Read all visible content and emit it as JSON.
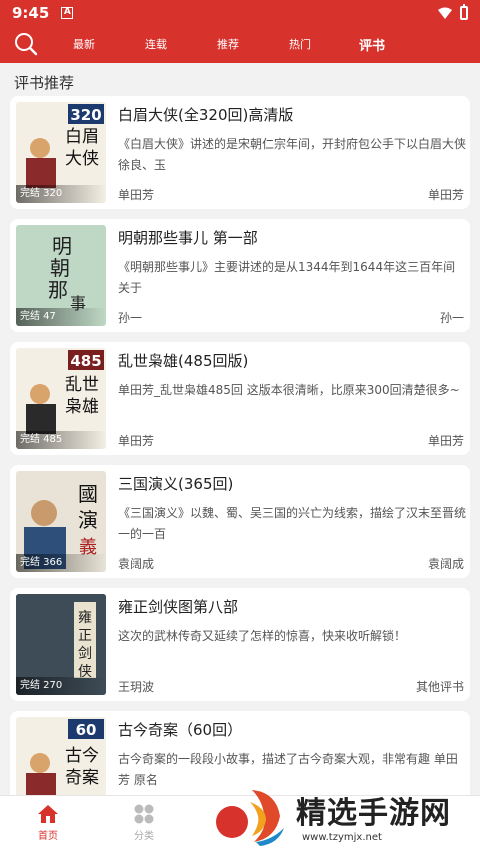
{
  "status": {
    "time": "9:45",
    "notif_letter": "A"
  },
  "nav": {
    "tabs": [
      {
        "label": "最新",
        "active": false
      },
      {
        "label": "连载",
        "active": false
      },
      {
        "label": "推荐",
        "active": false
      },
      {
        "label": "热门",
        "active": false
      },
      {
        "label": "评书",
        "active": true
      }
    ]
  },
  "section_title": "评书推荐",
  "books": [
    {
      "title": "白眉大侠(全320回)高清版",
      "desc": "《白眉大侠》讲述的是宋朝仁宗年间，开封府包公手下以白眉大侠徐良、玉",
      "author": "单田芳",
      "right": "单田芳",
      "badge": "完结 320",
      "cover_num": "320",
      "cover_text": "白眉大侠",
      "cover_color": "#f4efe4"
    },
    {
      "title": "明朝那些事儿 第一部",
      "desc": "《明朝那些事儿》主要讲述的是从1344年到1644年这三百年间关于",
      "author": "孙一",
      "right": "孙一",
      "badge": "完结 47",
      "cover_num": "",
      "cover_text": "明朝那些事",
      "cover_color": "#bfd8c5"
    },
    {
      "title": "乱世枭雄(485回版)",
      "desc": "单田芳_乱世枭雄485回  这版本很清晰，比原来300回清楚很多~",
      "author": "单田芳",
      "right": "单田芳",
      "badge": "完结 485",
      "cover_num": "485",
      "cover_text": "乱世枭雄",
      "cover_color": "#f4efe4"
    },
    {
      "title": "三国演义(365回)",
      "desc": "《三国演义》以魏、蜀、吴三国的兴亡为线索，描绘了汉末至晋统一的一百",
      "author": "袁阔成",
      "right": "袁阔成",
      "badge": "完结 366",
      "cover_num": "",
      "cover_text": "三國演義",
      "cover_color": "#e8e3d6"
    },
    {
      "title": "雍正剑侠图第八部",
      "desc": "这次的武林传奇又延续了怎样的惊喜，快来收听解锁！",
      "author": "王玥波",
      "right": "其他评书",
      "badge": "完结 270",
      "cover_num": "",
      "cover_text": "雍正剑侠图",
      "cover_color": "#33404a"
    },
    {
      "title": "古今奇案（60回）",
      "desc": "古今奇案的一段段小故事，描述了古今奇案大观，非常有趣  单田芳 原名",
      "author": "",
      "right": "",
      "badge": "",
      "cover_num": "60",
      "cover_text": "古今奇案",
      "cover_color": "#f4efe4"
    }
  ],
  "bottom_nav": [
    {
      "label": "首页",
      "active": true
    },
    {
      "label": "分类",
      "active": false
    }
  ],
  "watermark": {
    "text": "精选手游网",
    "url": "www.tzymjx.net"
  },
  "colors": {
    "brand_red": "#d8322d",
    "background": "#f2f2f2"
  }
}
